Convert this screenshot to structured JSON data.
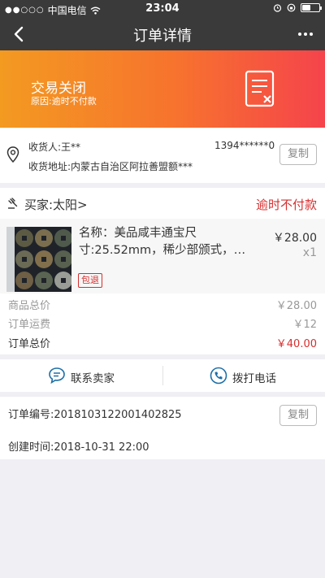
{
  "status_bar": {
    "signal": "●●○○○",
    "carrier": "中国电信",
    "time": "23:04",
    "battery_level": 0.5
  },
  "nav": {
    "title": "订单详情",
    "back_icon": "chevron-left-icon",
    "more_icon": "more-icon"
  },
  "status": {
    "state": "交易关闭",
    "reason": "原因:逾时不付款",
    "icon": "document-close-icon"
  },
  "address": {
    "recipient": "收货人:王**",
    "phone": "1394******0",
    "address": "收货地址:内蒙古自治区阿拉善盟额***",
    "copy_label": "复制"
  },
  "seller": {
    "name": "买家:太阳>",
    "state": "逾时不付款"
  },
  "product": {
    "title": "名称：美品咸丰通宝尺寸:25.52mm，稀少部颁式，…",
    "price": "￥28.00",
    "quantity": "x1",
    "tag": "包退"
  },
  "totals": [
    {
      "label": "商品总价",
      "value": "￥28.00"
    },
    {
      "label": "订单运费",
      "value": "￥12"
    },
    {
      "label": "订单总价",
      "value": "￥40.00"
    }
  ],
  "actions": {
    "contact_seller": "联系卖家",
    "call": "拨打电话"
  },
  "order": {
    "number": "订单编号:2018103122001402825",
    "copy_label": "复制",
    "created": "创建时间:2018-10-31 22:00"
  },
  "colors": {
    "accent_red": "#d72e2e",
    "nav_bg": "#3a3a3a",
    "icon_blue": "#1e6fa8"
  }
}
